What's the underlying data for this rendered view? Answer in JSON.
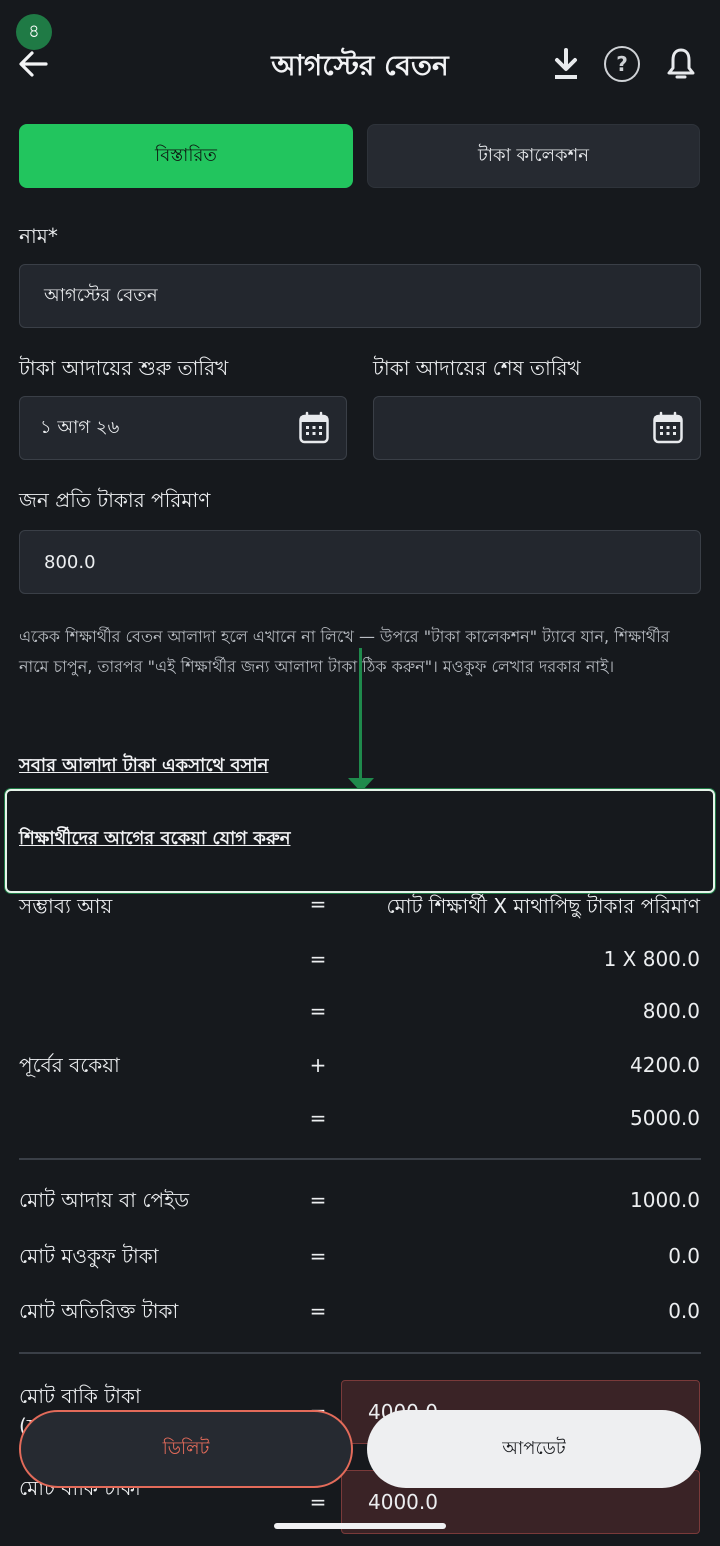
{
  "header": {
    "step_badge": "৪",
    "title": "আগস্টের বেতন",
    "icons": [
      "back-arrow-icon",
      "download-icon",
      "help-icon",
      "bell-icon"
    ],
    "help_glyph": "?"
  },
  "tabs": [
    {
      "label": "বিস্তারিত",
      "active": true
    },
    {
      "label": "টাকা কালেকশন",
      "active": false
    }
  ],
  "form": {
    "name_label": "নাম*",
    "name_value": "আগস্টের বেতন",
    "start_label": "টাকা আদায়ের শুরু তারিখ",
    "start_value": "১ আগ ২৬",
    "end_label": "টাকা আদায়ের শেষ তারিখ",
    "end_value": "",
    "amount_label": "জন প্রতি টাকার পরিমাণ",
    "amount_value": "800.0"
  },
  "hint_text": "একেক শিক্ষার্থীর বেতন আলাদা হলে এখানে না লিখে — উপরে \"টাকা কালেকশন\" ট্যাবে যান, শিক্ষার্থীর নামে চাপুন, তারপর \"এই শিক্ষার্থীর জন্য আলাদা টাকা ঠিক করুন\"। মওকুফ লেখার দরকার নাই।",
  "links": {
    "set_all": "সবার আলাদা টাকা একসাথে বসান",
    "add_dues": "শিক্ষার্থীদের আগের বকেয়া যোগ করুন"
  },
  "summary": {
    "rows": [
      {
        "label": "সম্ভাব্য আয়",
        "op": "=",
        "value": "মোট শিক্ষার্থী X মাথাপিছু টাকার পরিমাণ"
      },
      {
        "label": "",
        "op": "=",
        "value": "1 X 800.0"
      },
      {
        "label": "",
        "op": "=",
        "value": "800.0"
      },
      {
        "label": "পূর্বের বকেয়া",
        "op": "+",
        "value": "4200.0"
      },
      {
        "label": "",
        "op": "=",
        "value": "5000.0"
      }
    ],
    "totals": [
      {
        "label": "মোট আদায় বা পেইড",
        "op": "=",
        "value": "1000.0"
      },
      {
        "label": "মোট মওকুফ টাকা",
        "op": "=",
        "value": "0.0"
      },
      {
        "label": "মোট অতিরিক্ত টাকা",
        "op": "=",
        "value": "0.0"
      }
    ],
    "due_rows": [
      {
        "label": "মোট বাকি টাকা",
        "sub": "(স",
        "op": "=",
        "value": "4000.0"
      },
      {
        "label": "মোট বাকি টাকা",
        "op": "=",
        "value": "4000.0"
      }
    ]
  },
  "buttons": {
    "delete": "ডিলিট",
    "update": "আপডেট"
  },
  "colors": {
    "accent_green": "#22c55e",
    "danger": "#e36b5a",
    "background": "#16191d"
  }
}
